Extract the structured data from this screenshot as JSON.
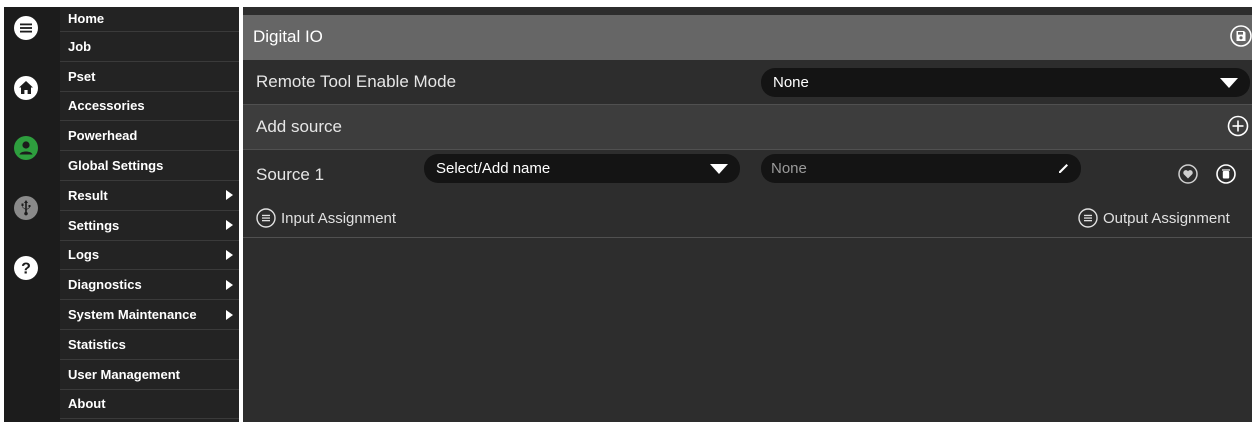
{
  "rail": {
    "icons": [
      "hamburger-menu-icon",
      "home-icon",
      "user-icon",
      "usb-icon",
      "help-icon"
    ],
    "accent": "#2e9e3e"
  },
  "menu": {
    "items": [
      {
        "label": "Home",
        "has_submenu": false
      },
      {
        "label": "Job",
        "has_submenu": false
      },
      {
        "label": "Pset",
        "has_submenu": false
      },
      {
        "label": "Accessories",
        "has_submenu": false
      },
      {
        "label": "Powerhead",
        "has_submenu": false
      },
      {
        "label": "Global Settings",
        "has_submenu": false
      },
      {
        "label": "Result",
        "has_submenu": true
      },
      {
        "label": "Settings",
        "has_submenu": true
      },
      {
        "label": "Logs",
        "has_submenu": true
      },
      {
        "label": "Diagnostics",
        "has_submenu": true
      },
      {
        "label": "System Maintenance",
        "has_submenu": true
      },
      {
        "label": "Statistics",
        "has_submenu": false
      },
      {
        "label": "User Management",
        "has_submenu": false
      },
      {
        "label": "About",
        "has_submenu": false
      }
    ]
  },
  "panel": {
    "title": "Digital IO",
    "save_icon": "save-icon",
    "remote_tool": {
      "label": "Remote Tool Enable Mode",
      "value": "None"
    },
    "add_source": {
      "label": "Add source",
      "icon": "plus-circle-icon"
    },
    "source": {
      "label": "Source 1",
      "name_select": "Select/Add name",
      "value_placeholder": "None",
      "icons": [
        "heart-icon",
        "delete-icon"
      ]
    },
    "input_assignment": "Input Assignment",
    "output_assignment": "Output Assignment"
  }
}
